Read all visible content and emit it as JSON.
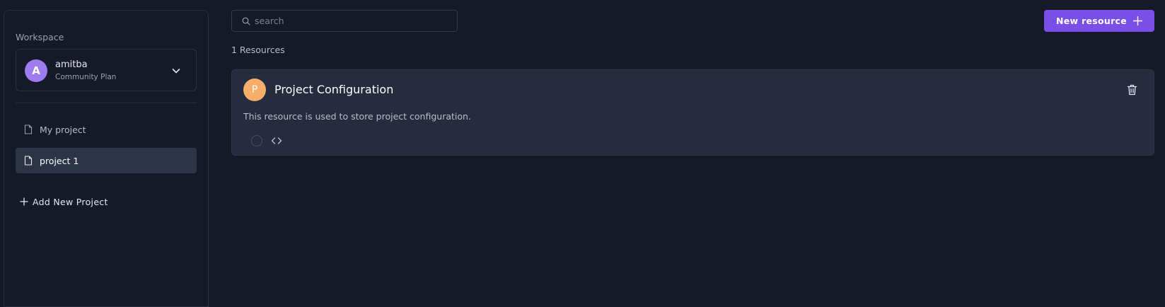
{
  "sidebar": {
    "workspace_label": "Workspace",
    "workspace": {
      "avatar_letter": "A",
      "name": "amitba",
      "plan": "Community Plan"
    },
    "projects": [
      {
        "label": "My project",
        "active": false
      },
      {
        "label": "project 1",
        "active": true
      }
    ],
    "add_project_label": "Add New Project"
  },
  "toolbar": {
    "search_placeholder": "search",
    "new_resource_label": "New resource"
  },
  "resources": {
    "count_label": "1 Resources",
    "items": [
      {
        "avatar_letter": "P",
        "title": "Project Configuration",
        "description": "This resource is used to store project configuration."
      }
    ]
  },
  "colors": {
    "background": "#161927",
    "card": "#262b3f",
    "accent": "#7b4ee8",
    "workspace_avatar": "#9d7cf0",
    "resource_avatar": "#f7ae6a"
  },
  "icons": {
    "search": "search-icon",
    "chevron": "chevron-down-icon",
    "file": "file-icon",
    "plus": "plus-icon",
    "trash": "trash-icon",
    "code": "code-icon",
    "status": "circle-icon"
  }
}
